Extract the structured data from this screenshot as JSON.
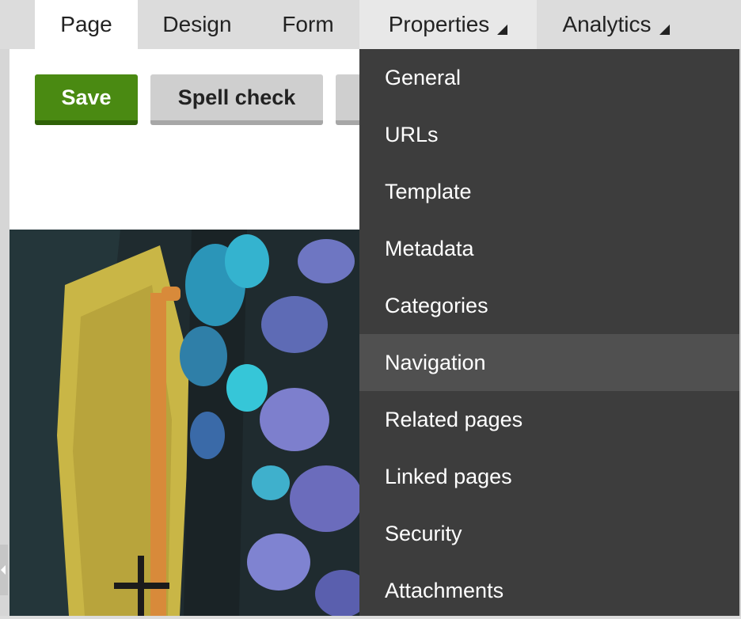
{
  "tabs": {
    "page": "Page",
    "design": "Design",
    "form": "Form",
    "properties": "Properties",
    "analytics": "Analytics"
  },
  "toolbar": {
    "save_label": "Save",
    "spell_label": "Spell check"
  },
  "properties_menu": {
    "items": [
      "General",
      "URLs",
      "Template",
      "Metadata",
      "Categories",
      "Navigation",
      "Related pages",
      "Linked pages",
      "Security",
      "Attachments"
    ],
    "highlighted": "Navigation"
  },
  "colors": {
    "save_button": "#4a8a12",
    "menu_background": "#3d3d3d",
    "menu_highlight": "#505050"
  }
}
